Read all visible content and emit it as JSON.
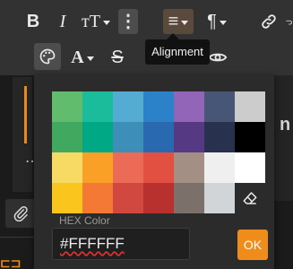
{
  "toolbar": {
    "row1": [
      {
        "id": "bold",
        "label": "B",
        "icon": "bold-icon"
      },
      {
        "id": "italic",
        "label": "I",
        "icon": "italic-icon"
      },
      {
        "id": "font-size",
        "label": "тT",
        "icon": "font-size-icon",
        "dropdown": true
      },
      {
        "id": "more",
        "label": "⋮",
        "icon": "more-vertical-icon"
      },
      {
        "id": "align",
        "label": "≡",
        "icon": "align-icon",
        "dropdown": true,
        "active": true
      },
      {
        "id": "paragraph",
        "label": "¶",
        "icon": "paragraph-icon",
        "dropdown": true
      },
      {
        "id": "link",
        "label": "",
        "icon": "link-icon"
      },
      {
        "id": "undo",
        "label": "",
        "icon": "undo-icon"
      }
    ],
    "row2": [
      {
        "id": "text-color",
        "label": "",
        "icon": "palette-icon",
        "pressed": true
      },
      {
        "id": "font-family",
        "label": "A",
        "icon": "font-family-icon",
        "dropdown": true
      },
      {
        "id": "strikethrough",
        "label": "S",
        "icon": "strikethrough-icon"
      },
      {
        "id": "hidden",
        "label": "",
        "icon": "eye-icon"
      }
    ]
  },
  "tooltip": {
    "text": "Alignment"
  },
  "picker": {
    "swatches": [
      [
        "#61bd6d",
        "#1abc9c",
        "#54acd2",
        "#2c82c9",
        "#9365b8",
        "#475577",
        "#cccccc"
      ],
      [
        "#41a85f",
        "#00a885",
        "#3d8eb9",
        "#2969b0",
        "#553982",
        "#28324e",
        "#000000"
      ],
      [
        "#f7da64",
        "#fba026",
        "#eb6b56",
        "#e25041",
        "#a38f84",
        "#efefef",
        "#ffffff"
      ],
      [
        "#fac51c",
        "#f37934",
        "#d14841",
        "#b8312f",
        "#7c706b",
        "#d1d5d8",
        "eraser"
      ]
    ],
    "selected": "#ffffff",
    "hex_label": "HEX Color",
    "hex_value": "#FFFFFF",
    "ok_label": "OK",
    "colors": {
      "accent": "#f08c1a",
      "panel": "#2b2b2b"
    }
  }
}
